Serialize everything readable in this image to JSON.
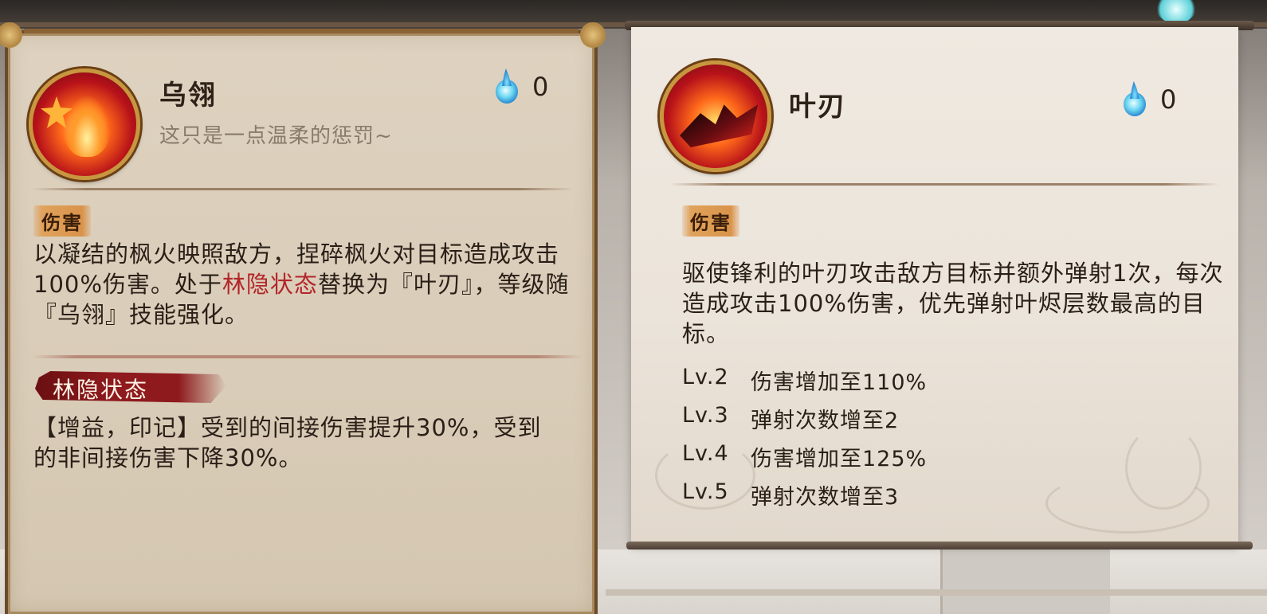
{
  "left_skill": {
    "name": "乌翎",
    "quote": "这只是一点温柔的惩罚~",
    "icon": "crimson-flame-crow-icon",
    "cost": "0",
    "tag": "伤害",
    "desc_part1": "以凝结的枫火映照敌方，捏碎枫火对目标造成攻击100%伤害。处于",
    "desc_term": "林隐状态",
    "desc_part2": "替换为『叶刃』，等级随『乌翎』技能强化。",
    "status": {
      "name": "林隐状态",
      "desc": "【增益，印记】受到的间接伤害提升30%，受到的非间接伤害下降30%。"
    }
  },
  "right_skill": {
    "name": "叶刃",
    "icon": "leaf-blade-icon",
    "cost": "0",
    "tag": "伤害",
    "desc": "驱使锋利的叶刃攻击敌方目标并额外弹射1次，每次造成攻击100%伤害，优先弹射叶烬层数最高的目标。",
    "levels": [
      {
        "level": "Lv.2",
        "effect": "伤害增加至110%"
      },
      {
        "level": "Lv.3",
        "effect": "弹射次数增至2"
      },
      {
        "level": "Lv.4",
        "effect": "伤害增加至125%"
      },
      {
        "level": "Lv.5",
        "effect": "弹射次数增至3"
      }
    ]
  },
  "colors": {
    "highlight_term": "#b3262a",
    "tag_bg": "#e0a25c",
    "status_banner": "#8e1a1d"
  }
}
